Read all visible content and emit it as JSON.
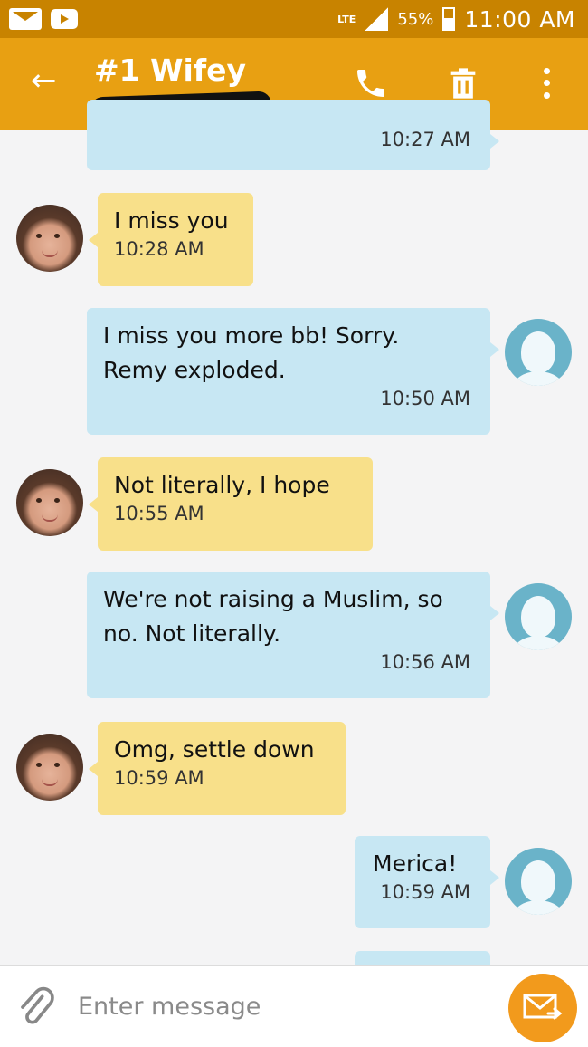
{
  "status_bar": {
    "network": "LTE",
    "battery": "55%",
    "time": "11:00 AM",
    "icons": [
      "mail-icon",
      "youtube-icon",
      "signal-icon",
      "battery-icon"
    ]
  },
  "header": {
    "back_icon": "back-arrow-icon",
    "contact_name": "#1 Wifey",
    "call_icon": "phone-icon",
    "delete_icon": "trash-icon",
    "menu_icon": "more-vert-icon"
  },
  "messages": [
    {
      "direction": "out",
      "text": "",
      "time": "10:27 AM"
    },
    {
      "direction": "in",
      "text": "I miss you",
      "time": "10:28 AM"
    },
    {
      "direction": "out",
      "text": "I miss you more bb! Sorry. Remy exploded.",
      "time": "10:50 AM"
    },
    {
      "direction": "in",
      "text": "Not literally, I hope",
      "time": "10:55 AM"
    },
    {
      "direction": "out",
      "text": "We're not raising a Muslim, so no. Not literally.",
      "time": "10:56 AM"
    },
    {
      "direction": "in",
      "text": "Omg, settle down",
      "time": "10:59 AM"
    },
    {
      "direction": "out",
      "text": "Merica!",
      "time": "10:59 AM"
    }
  ],
  "composer": {
    "placeholder": "Enter message",
    "attach_icon": "paperclip-icon",
    "send_icon": "send-mail-icon"
  },
  "colors": {
    "status_bar": "#c88300",
    "app_bar": "#e8a012",
    "incoming_bubble": "#f8e08a",
    "outgoing_bubble": "#c7e7f3",
    "send_button": "#f29a1c"
  }
}
